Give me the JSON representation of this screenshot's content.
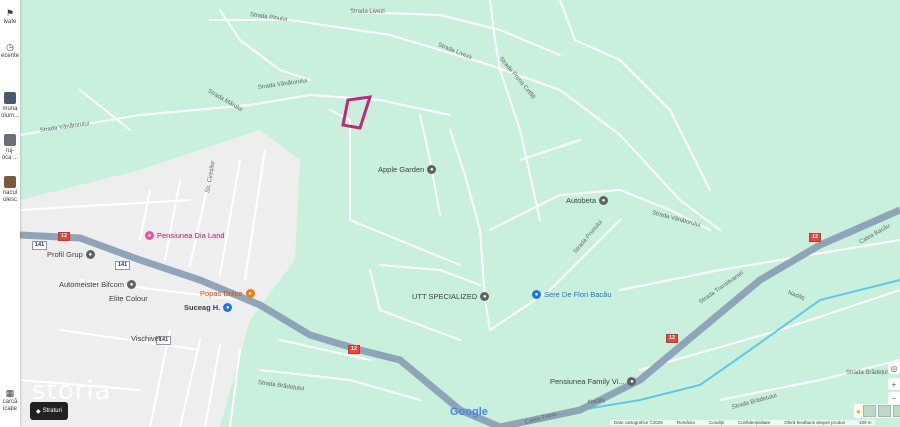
{
  "sidebar": {
    "saved_label": "lvate",
    "recent_label": "ecente",
    "items": [
      {
        "label": "muna\nolum..."
      },
      {
        "label": "ruj-\noca ..."
      },
      {
        "label": "nacul\nulesc"
      }
    ],
    "bottom_label": "carcă\nicație"
  },
  "map": {
    "watermark": "storia",
    "layers_button": "Straturi",
    "google_logo": "Google",
    "footer": [
      "Date cartografice ©2025",
      "România",
      "Condiții",
      "Confidențialitate",
      "Oferă feedback despre produs",
      "100 m"
    ],
    "places": [
      {
        "name": "Apple Garden"
      },
      {
        "name": "Autobeta"
      },
      {
        "name": "Pensiunea Dia Land"
      },
      {
        "name": "Profil Grup"
      },
      {
        "name": "Automeister Bifcom"
      },
      {
        "name": "Elite Colour"
      },
      {
        "name": "Popas Dulce"
      },
      {
        "name": "Suceag H."
      },
      {
        "name": "Vischivet"
      },
      {
        "name": "UTT SPECIALIZED"
      },
      {
        "name": "Sere De Flori Bacău"
      },
      {
        "name": "Pensiunea Family Vi..."
      }
    ],
    "streets": [
      "Strada Livezi",
      "Strada Livezii",
      "Strada Pinului",
      "Strada Mărului",
      "Strada Vânătorului",
      "Strada Vânătorului",
      "Strada Vânătorului",
      "Strada Prunului",
      "Strada Pruna Cetăți",
      "Strada Brădețului",
      "Strada Brădețului",
      "Strada Brădetului",
      "Calea Bacău",
      "Calea Trans...",
      "Nadăș",
      "Nadăș",
      "Strada Transilvaniei",
      "Str. Cireșilor"
    ],
    "road_shields": [
      "141",
      "141",
      "141",
      "12",
      "12",
      "12",
      "12"
    ]
  }
}
